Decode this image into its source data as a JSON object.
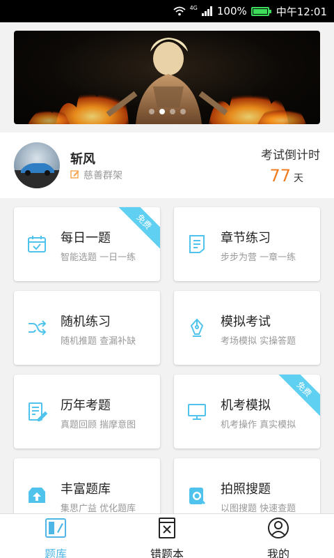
{
  "status_bar": {
    "network": "4G",
    "battery": "100%",
    "battery_level": 1.0,
    "time": "中午12:01"
  },
  "banner": {
    "slide_count": 4,
    "active_slide": 1
  },
  "profile": {
    "username": "斩风",
    "signature": "慈善群架",
    "countdown_label": "考试倒计时",
    "countdown_value": "77",
    "countdown_unit": "天"
  },
  "cards": [
    {
      "title": "每日一题",
      "subtitle": "智能选题 一日一练",
      "icon": "calendar-check-icon",
      "badge": "免费"
    },
    {
      "title": "章节练习",
      "subtitle": "步步为营 一章一练",
      "icon": "document-lines-icon",
      "badge": ""
    },
    {
      "title": "随机练习",
      "subtitle": "随机推题 查漏补缺",
      "icon": "shuffle-icon",
      "badge": ""
    },
    {
      "title": "模拟考试",
      "subtitle": "考场模拟 实操答题",
      "icon": "pen-nib-icon",
      "badge": ""
    },
    {
      "title": "历年考题",
      "subtitle": "真题回顾 揣摩意图",
      "icon": "paper-edit-icon",
      "badge": ""
    },
    {
      "title": "机考模拟",
      "subtitle": "机考操作 真实模拟",
      "icon": "monitor-icon",
      "badge": "免费"
    },
    {
      "title": "丰富题库",
      "subtitle": "集思广益 优化题库",
      "icon": "upload-box-icon",
      "badge": ""
    },
    {
      "title": "拍照搜题",
      "subtitle": "以图搜题 快速查题",
      "icon": "photo-search-icon",
      "badge": ""
    }
  ],
  "bottom_nav": {
    "items": [
      {
        "label": "题库",
        "icon": "question-bank-icon",
        "active": true
      },
      {
        "label": "错题本",
        "icon": "wrong-notebook-icon",
        "active": false
      },
      {
        "label": "我的",
        "icon": "user-circle-icon",
        "active": false
      }
    ]
  },
  "colors": {
    "accent": "#4fb7e5",
    "ribbon": "#5fd0f2",
    "countdown": "#f07c22",
    "battery": "#3ddc5b"
  }
}
